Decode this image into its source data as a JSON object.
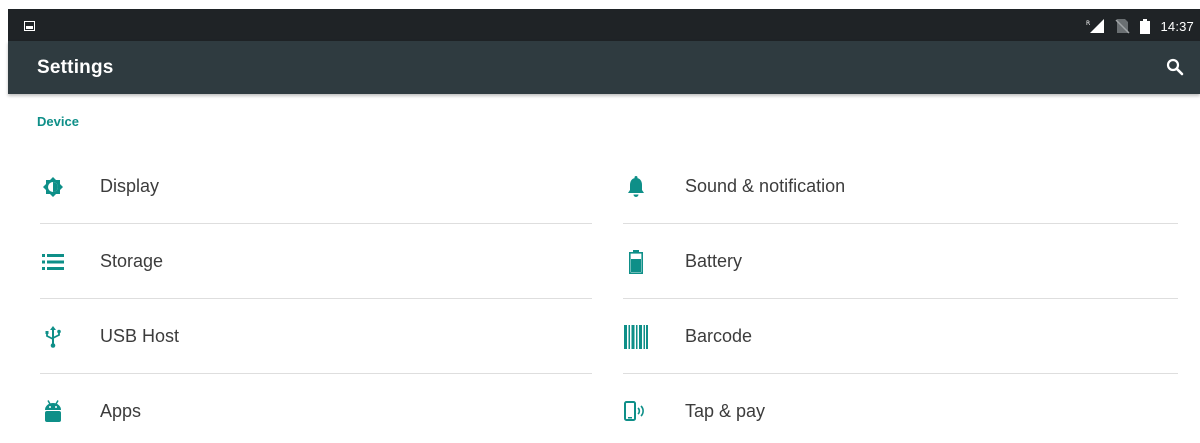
{
  "status_bar": {
    "time": "14:37",
    "icons": [
      "notification-icon",
      "signal-icon",
      "no-sim-icon",
      "battery-icon"
    ]
  },
  "action_bar": {
    "title": "Settings",
    "search_icon": "search-icon"
  },
  "section": {
    "title": "Device"
  },
  "items": [
    {
      "label": "Display",
      "icon": "brightness-icon"
    },
    {
      "label": "Sound & notification",
      "icon": "bell-icon"
    },
    {
      "label": "Storage",
      "icon": "storage-list-icon"
    },
    {
      "label": "Battery",
      "icon": "battery-icon"
    },
    {
      "label": "USB Host",
      "icon": "usb-icon"
    },
    {
      "label": "Barcode",
      "icon": "barcode-icon"
    },
    {
      "label": "Apps",
      "icon": "android-icon"
    },
    {
      "label": "Tap & pay",
      "icon": "tap-pay-icon"
    }
  ],
  "colors": {
    "status_bar": "#1f2326",
    "action_bar": "#2f3b40",
    "accent": "#0e8f88",
    "text": "#3c3c3c",
    "divider": "#dedede"
  }
}
